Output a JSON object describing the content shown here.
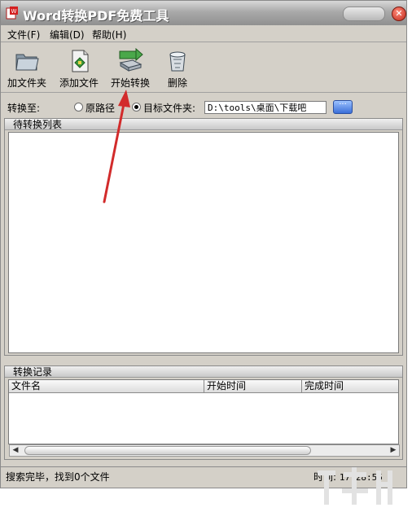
{
  "window": {
    "title": "Word转换PDF免费工具",
    "close_glyph": "✕"
  },
  "menu": [
    "文件(F)",
    "编辑(D)",
    "帮助(H)"
  ],
  "toolbar": {
    "add_folder": "加文件夹",
    "add_file": "添加文件",
    "start_convert": "开始转换",
    "delete": "删除"
  },
  "convert_to": {
    "label": "转换至:",
    "option_original": "原路径",
    "option_target": "目标文件夹:",
    "selected": "目标文件夹",
    "path_value": "D:\\tools\\桌面\\下载吧",
    "browse_label": "···"
  },
  "pending_list": {
    "title": "待转换列表",
    "items": []
  },
  "records": {
    "title": "转换记录",
    "columns": [
      "文件名",
      "开始时间",
      "完成时间"
    ],
    "rows": []
  },
  "status": {
    "message": "搜索完毕，找到0个文件",
    "time_label": "时间:",
    "time_value": "17:28:55"
  },
  "colors": {
    "window_bg": "#d4d0c8",
    "annotation_arrow": "#d22b2b"
  },
  "icons": {
    "app": "word-pdf-app-icon",
    "add_folder": "folder-icon",
    "add_file": "file-icon",
    "start_convert": "convert-icon",
    "delete": "recycle-bin-icon"
  }
}
